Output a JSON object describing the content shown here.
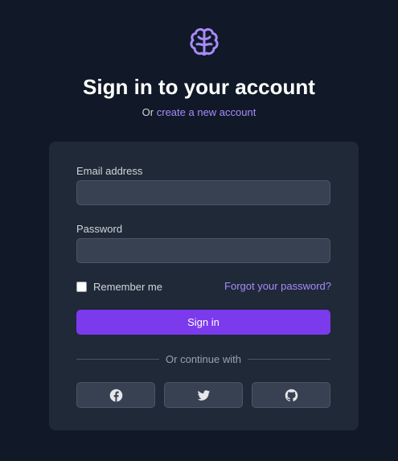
{
  "header": {
    "title": "Sign in to your account",
    "subtitle_prefix": "Or",
    "create_account_link": "create a new account"
  },
  "form": {
    "email_label": "Email address",
    "email_value": "",
    "password_label": "Password",
    "password_value": "",
    "remember_label": "Remember me",
    "remember_checked": false,
    "forgot_link": "Forgot your password?",
    "submit_label": "Sign in",
    "divider_text": "Or continue with"
  },
  "social": [
    {
      "icon": "facebook-icon"
    },
    {
      "icon": "twitter-icon"
    },
    {
      "icon": "github-icon"
    }
  ],
  "colors": {
    "background": "#111827",
    "card": "#1f2937",
    "input": "#374151",
    "accent": "#7c3aed",
    "link": "#a78bfa"
  }
}
